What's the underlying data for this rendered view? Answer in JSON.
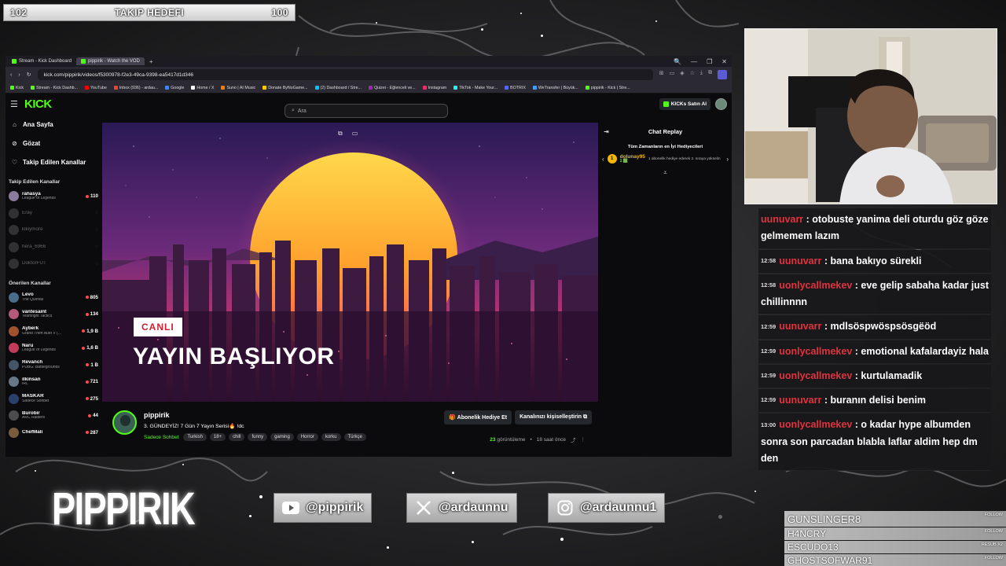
{
  "goal": {
    "current": "102",
    "label": "TAKIP HEDEFI",
    "target": "100"
  },
  "browser": {
    "tabs": [
      {
        "label": "Stream - Kick Dashboard"
      },
      {
        "label": "pippirik - Watch the VOD"
      }
    ],
    "tab_add": "+",
    "controls": [
      "🔍",
      "—",
      "❐",
      "✕"
    ],
    "url": "kick.com/pippirik/videos/f5300978-f2e3-49ca-9398-ea5417d1d346",
    "bookmarks": [
      {
        "label": "Kick",
        "color": "#53fc18"
      },
      {
        "label": "Stream - Kick Dashb...",
        "color": "#53fc18"
      },
      {
        "label": "YouTube",
        "color": "#ff0000"
      },
      {
        "label": "Inbox (936) - ardau...",
        "color": "#ea4335"
      },
      {
        "label": "Google",
        "color": "#4285f4"
      },
      {
        "label": "Home / X",
        "color": "#ffffff"
      },
      {
        "label": "Suno | AI Music",
        "color": "#ff7b00"
      },
      {
        "label": "Donate ByNoGame...",
        "color": "#ffcc00"
      },
      {
        "label": "(2) Dashboard / Stre...",
        "color": "#00c2ff"
      },
      {
        "label": "Quizei - Eğlenceli ve...",
        "color": "#9c27b0"
      },
      {
        "label": "Instagram",
        "color": "#e1306c"
      },
      {
        "label": "TikTok - Make Your...",
        "color": "#25f4ee"
      },
      {
        "label": "BOTRIX",
        "color": "#5865f2"
      },
      {
        "label": "WeTransfer | Büyük...",
        "color": "#409fff"
      },
      {
        "label": "pippirik - Kick | Stre...",
        "color": "#53fc18"
      }
    ]
  },
  "kick": {
    "logo": "KICK",
    "search_placeholder": "Ara",
    "kicks_button": "KICKs Satın Al",
    "nav": [
      {
        "label": "Ana Sayfa",
        "icon": "home-icon",
        "glyph": "⌂"
      },
      {
        "label": "Gözat",
        "icon": "compass-icon",
        "glyph": "⊘"
      },
      {
        "label": "Takip Edilen Kanallar",
        "icon": "heart-icon",
        "glyph": "♡"
      }
    ],
    "followed_title": "Takip Edilen Kanallar",
    "followed": [
      {
        "name": "rahasya",
        "game": "League of Legends",
        "viewers": "110",
        "color": "#8a7b9e",
        "live": true
      },
      {
        "name": "Eray",
        "game": "",
        "viewers": "",
        "color": "#777",
        "live": false
      },
      {
        "name": "kikiymore",
        "game": "",
        "viewers": "",
        "color": "#777",
        "live": false
      },
      {
        "name": "hera_6966",
        "game": "",
        "viewers": "",
        "color": "#777",
        "live": false
      },
      {
        "name": "DoktorFUT",
        "game": "",
        "viewers": "",
        "color": "#777",
        "live": false
      }
    ],
    "recommended_title": "Önerilen Kanallar",
    "recommended": [
      {
        "name": "Levo",
        "game": "The Quinfall",
        "viewers": "805",
        "color": "#4a6d8c"
      },
      {
        "name": "vantesaint",
        "game": "Teamfight Tactics",
        "viewers": "134",
        "color": "#b55a7a"
      },
      {
        "name": "Ayberk",
        "game": "Grand Theft Auto V (...",
        "viewers": "1,9 B",
        "color": "#a0522d"
      },
      {
        "name": "Naru",
        "game": "League of Legends",
        "viewers": "1,6 B",
        "color": "#c23b5a"
      },
      {
        "name": "Revanch",
        "game": "PUBG: Battlegrounds",
        "viewers": "1 B",
        "color": "#445566"
      },
      {
        "name": "ilkinsan",
        "game": "IRL",
        "viewers": "721",
        "color": "#667788"
      },
      {
        "name": "MASKAR",
        "game": "Sadece Sohbet",
        "viewers": "275",
        "color": "#2b3f6b"
      },
      {
        "name": "Burobir",
        "game": "ARC Raiders",
        "viewers": "44",
        "color": "#4c4c4c"
      },
      {
        "name": "ChefMali",
        "game": "",
        "viewers": "287",
        "color": "#7a5c3c"
      }
    ],
    "player": {
      "live_badge": "CANLI",
      "headline": "YAYIN BAŞLIYOR"
    },
    "stream": {
      "channel": "pippirik",
      "title": "3. GÜNDEYİZ! 7 Gün 7 Yayın Serisi🔥 !dc",
      "category": "Sadece Sohbet",
      "tags": [
        "Turkish",
        "18+",
        "chill",
        "funny",
        "gaming",
        "Horror",
        "korku",
        "Türkçe"
      ],
      "gift_button": "Abonelik Hediye Et",
      "customize_button": "Kanalınızı kişiselleştirin ⧉",
      "views": "23",
      "views_label": "görüntüleme",
      "time_ago": "18 saat önce"
    },
    "chat": {
      "title": "Chat Replay",
      "gifters_title": "Tüm Zamanların en İyi Hediyecileri",
      "gifter_rank": "1",
      "gifter_name": "dolunay95",
      "gifter_sub": "1 🟩",
      "gifter_desc": "1 abonelik hediye ederek 2. sıraya yükselin"
    }
  },
  "overlay_chat": [
    {
      "time": "",
      "user": "uunuvarr",
      "text": "otobuste yanima deli oturdu göz göze gelmemem lazım"
    },
    {
      "time": "12:58",
      "user": "uunuvarr",
      "text": "bana bakıyo sürekli"
    },
    {
      "time": "12:58",
      "user": "uonlycallmekev",
      "text": "eve gelip sabaha kadar just chillinnnn"
    },
    {
      "time": "12:59",
      "user": "uunuvarr",
      "text": "mdlsöspwöspsösgëöd"
    },
    {
      "time": "12:59",
      "user": "uonlycallmekev",
      "text": "emotional kafalardayiz hala"
    },
    {
      "time": "12:59",
      "user": "uonlycallmekev",
      "text": "kurtulamadik"
    },
    {
      "time": "12:59",
      "user": "uunuvarr",
      "text": "buranın delisi benim"
    },
    {
      "time": "13:00",
      "user": "uonlycallmekev",
      "text": "o kadar hype albumden sonra son parcadan blabla laflar aldim hep dm den"
    }
  ],
  "branding": {
    "logo_text": "PIPPIRIK",
    "socials": [
      {
        "icon": "youtube-icon",
        "handle": "@pippirik"
      },
      {
        "icon": "x-icon",
        "handle": "@ardaunnu"
      },
      {
        "icon": "instagram-icon",
        "handle": "@ardaunnu1"
      }
    ]
  },
  "alerts": [
    {
      "name": "GUNSLINGER8",
      "type": "FOLLOW"
    },
    {
      "name": "H4NCRY",
      "type": "FOLLOW"
    },
    {
      "name": "ESCUDO13",
      "type": "RESUB X2"
    },
    {
      "name": "GHOSTSOFWAR91",
      "type": "FOLLOW"
    }
  ]
}
